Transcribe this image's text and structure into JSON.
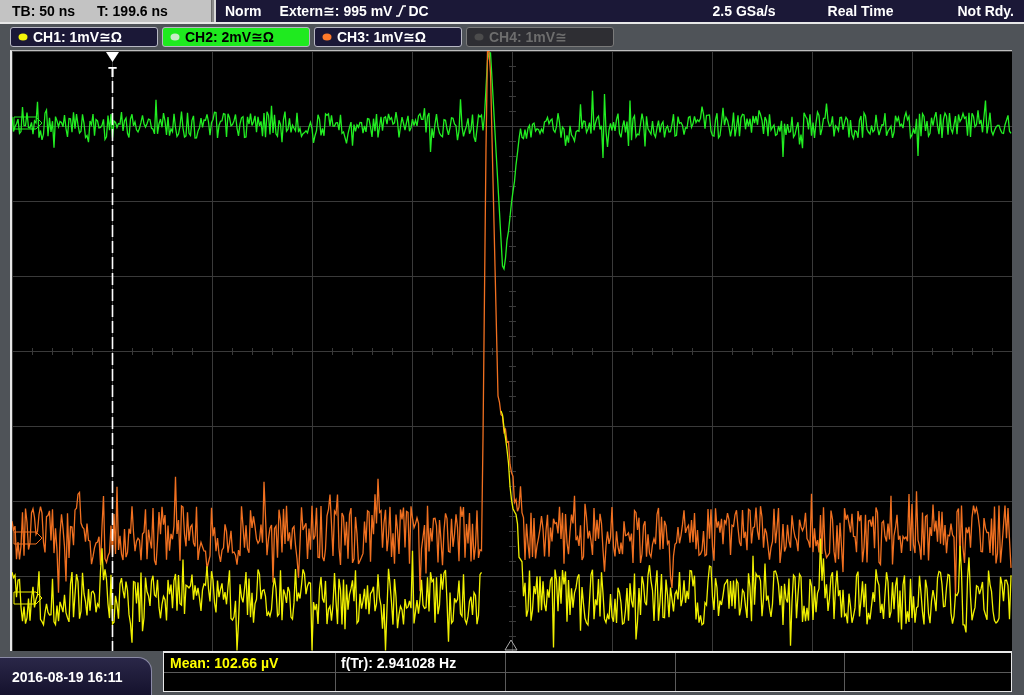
{
  "status_bar": {
    "timebase": "TB: 50 ns",
    "trigger_time": "T: 199.6 ns",
    "mode": "Norm",
    "trigger": "Extern≅: 995 mV",
    "coupling": "DC",
    "sample_rate": "2.5 GSa/s",
    "acquisition": "Real Time",
    "state": "Not Rdy."
  },
  "channels": [
    {
      "label": "CH1: 1mV≅Ω",
      "color": "#f5f50a",
      "selected": false,
      "disabled": false
    },
    {
      "label": "CH2: 2mV≅Ω",
      "color": "#c8ecc8",
      "selected": true,
      "disabled": false
    },
    {
      "label": "CH3: 1mV≅Ω",
      "color": "#ff7a2a",
      "selected": false,
      "disabled": false
    },
    {
      "label": "CH4: 1mV≅",
      "color": "#4c4c4c",
      "selected": false,
      "disabled": true
    }
  ],
  "display": {
    "trigger_marker": "T"
  },
  "timestamp": "2016-08-19 16:11",
  "measurements": [
    {
      "label": "Mean: 102.66 µV",
      "kind": "channel"
    },
    {
      "label": "f(Tr): 2.941028 Hz",
      "kind": "trigger"
    }
  ]
}
